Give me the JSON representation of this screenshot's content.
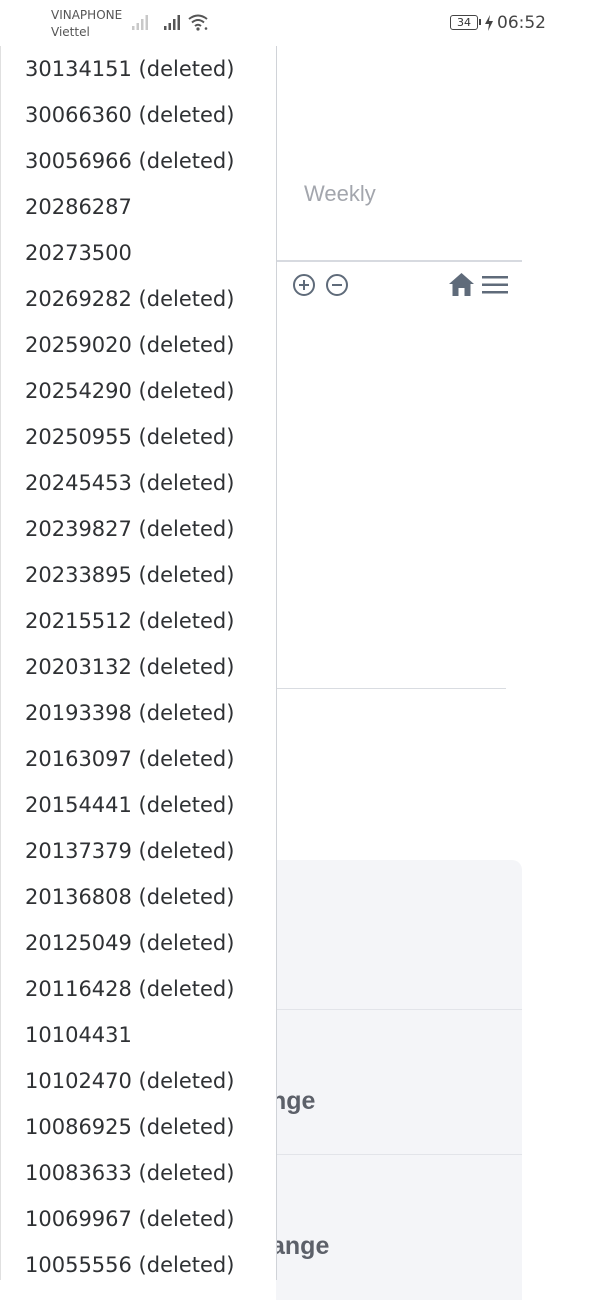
{
  "status_bar": {
    "carrier_1": "VINAPHONE",
    "carrier_2": "Viettel",
    "battery": "34",
    "time": "06:52",
    "icons": [
      "signal-icon",
      "signal-icon",
      "wifi-icon",
      "charging-bolt-icon"
    ]
  },
  "background": {
    "tab_label": "Weekly",
    "toolbar_icons": [
      "zoom-in-icon",
      "zoom-out-icon",
      "home-icon",
      "menu-icon"
    ],
    "range_label_1": "nge",
    "range_label_2": "ange"
  },
  "dropdown": {
    "options": [
      "30134151 (deleted)",
      "30066360 (deleted)",
      "30056966 (deleted)",
      "20286287",
      "20273500",
      "20269282 (deleted)",
      "20259020 (deleted)",
      "20254290 (deleted)",
      "20250955 (deleted)",
      "20245453 (deleted)",
      "20239827 (deleted)",
      "20233895 (deleted)",
      "20215512 (deleted)",
      "20203132 (deleted)",
      "20193398 (deleted)",
      "20163097 (deleted)",
      "20154441 (deleted)",
      "20137379 (deleted)",
      "20136808 (deleted)",
      "20125049 (deleted)",
      "20116428 (deleted)",
      "10104431",
      "10102470 (deleted)",
      "10086925 (deleted)",
      "10083633 (deleted)",
      "10069967 (deleted)",
      "10055556 (deleted)"
    ]
  },
  "colors": {
    "text": "#2f3134",
    "muted": "#a3a6ad",
    "icon": "#5f6b7a",
    "card": "#f4f5f8"
  }
}
